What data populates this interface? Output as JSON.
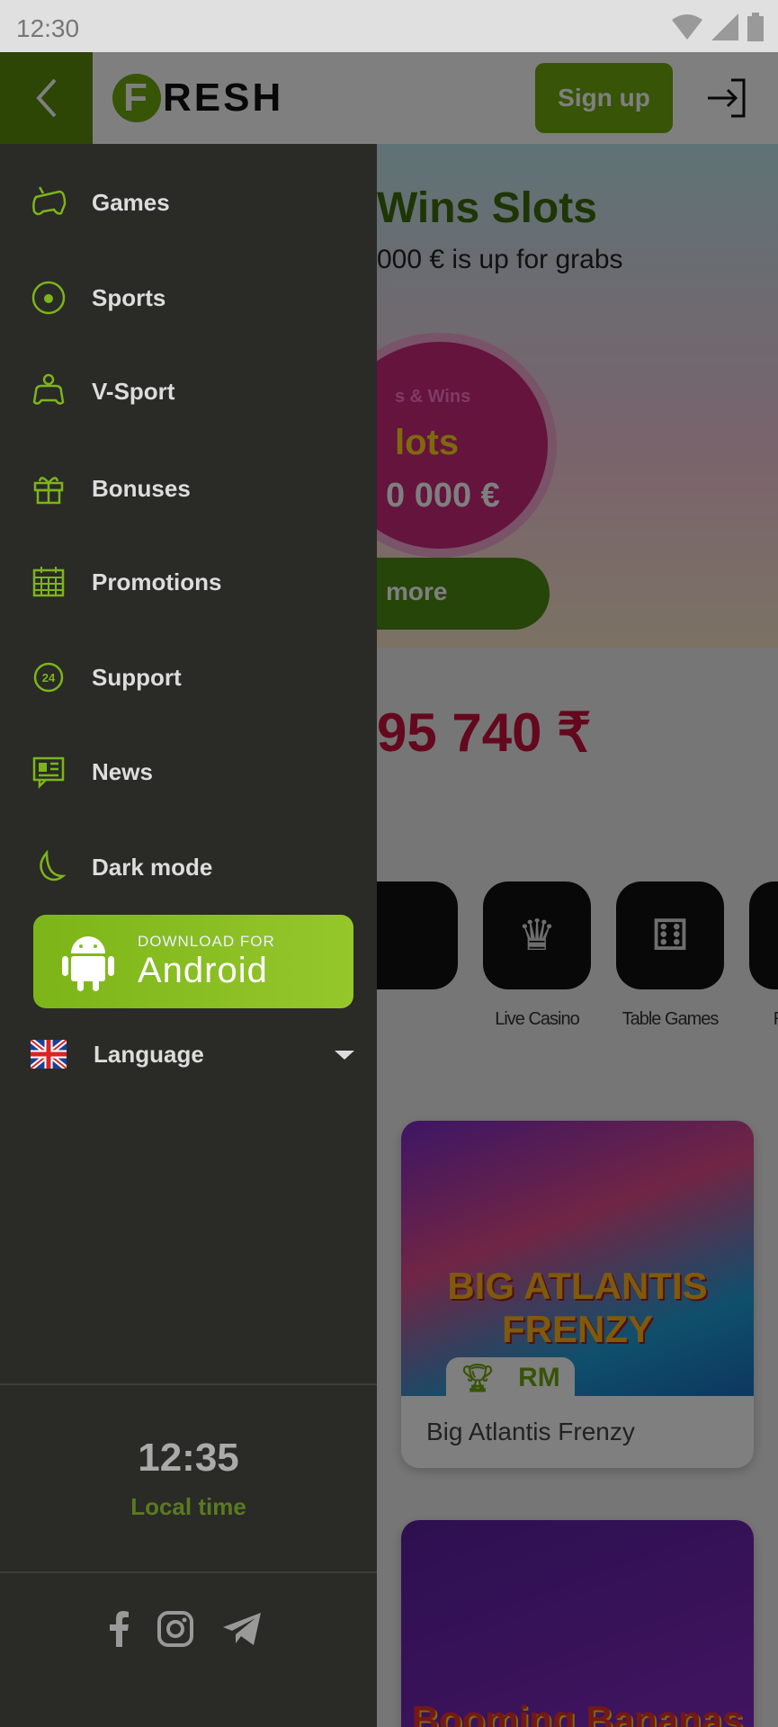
{
  "status_bar": {
    "time": "12:30"
  },
  "header": {
    "logo_letter": "F",
    "logo_rest": "RESH",
    "signup_label": "Sign up"
  },
  "colors": {
    "accent": "#6fa80f",
    "sidebar_bg": "#2a2a27",
    "back_bg": "#5a8a0a"
  },
  "menu": {
    "items": [
      {
        "label": "Games",
        "icon": "gamepad-icon"
      },
      {
        "label": "Sports",
        "icon": "soccer-ball-icon"
      },
      {
        "label": "V-Sport",
        "icon": "virtual-sport-icon"
      },
      {
        "label": "Bonuses",
        "icon": "gift-icon"
      },
      {
        "label": "Promotions",
        "icon": "calendar-icon"
      },
      {
        "label": "Support",
        "icon": "support-24-icon"
      },
      {
        "label": "News",
        "icon": "news-icon"
      },
      {
        "label": "Dark mode",
        "icon": "moon-icon"
      }
    ]
  },
  "android": {
    "small": "DOWNLOAD FOR",
    "big": "Android"
  },
  "language": {
    "label": "Language"
  },
  "clock": {
    "time": "12:35",
    "label": "Local time"
  },
  "main": {
    "banner": {
      "title": "Wins Slots",
      "subtitle": "000 € is up for grabs",
      "circle_top": "s & Wins",
      "circle_mid": "lots",
      "circle_amount": "0 000 €",
      "more": "more"
    },
    "jackpot": "95 740 ₹",
    "categories": [
      "Live Casino",
      "Table Games",
      "Roulette"
    ],
    "games": [
      {
        "name": "Big Atlantis Frenzy",
        "art_title": "BIG ATLANTIS FRENZY",
        "badge": "RM"
      },
      {
        "name": "",
        "art_title": "Booming Bananas"
      }
    ]
  }
}
